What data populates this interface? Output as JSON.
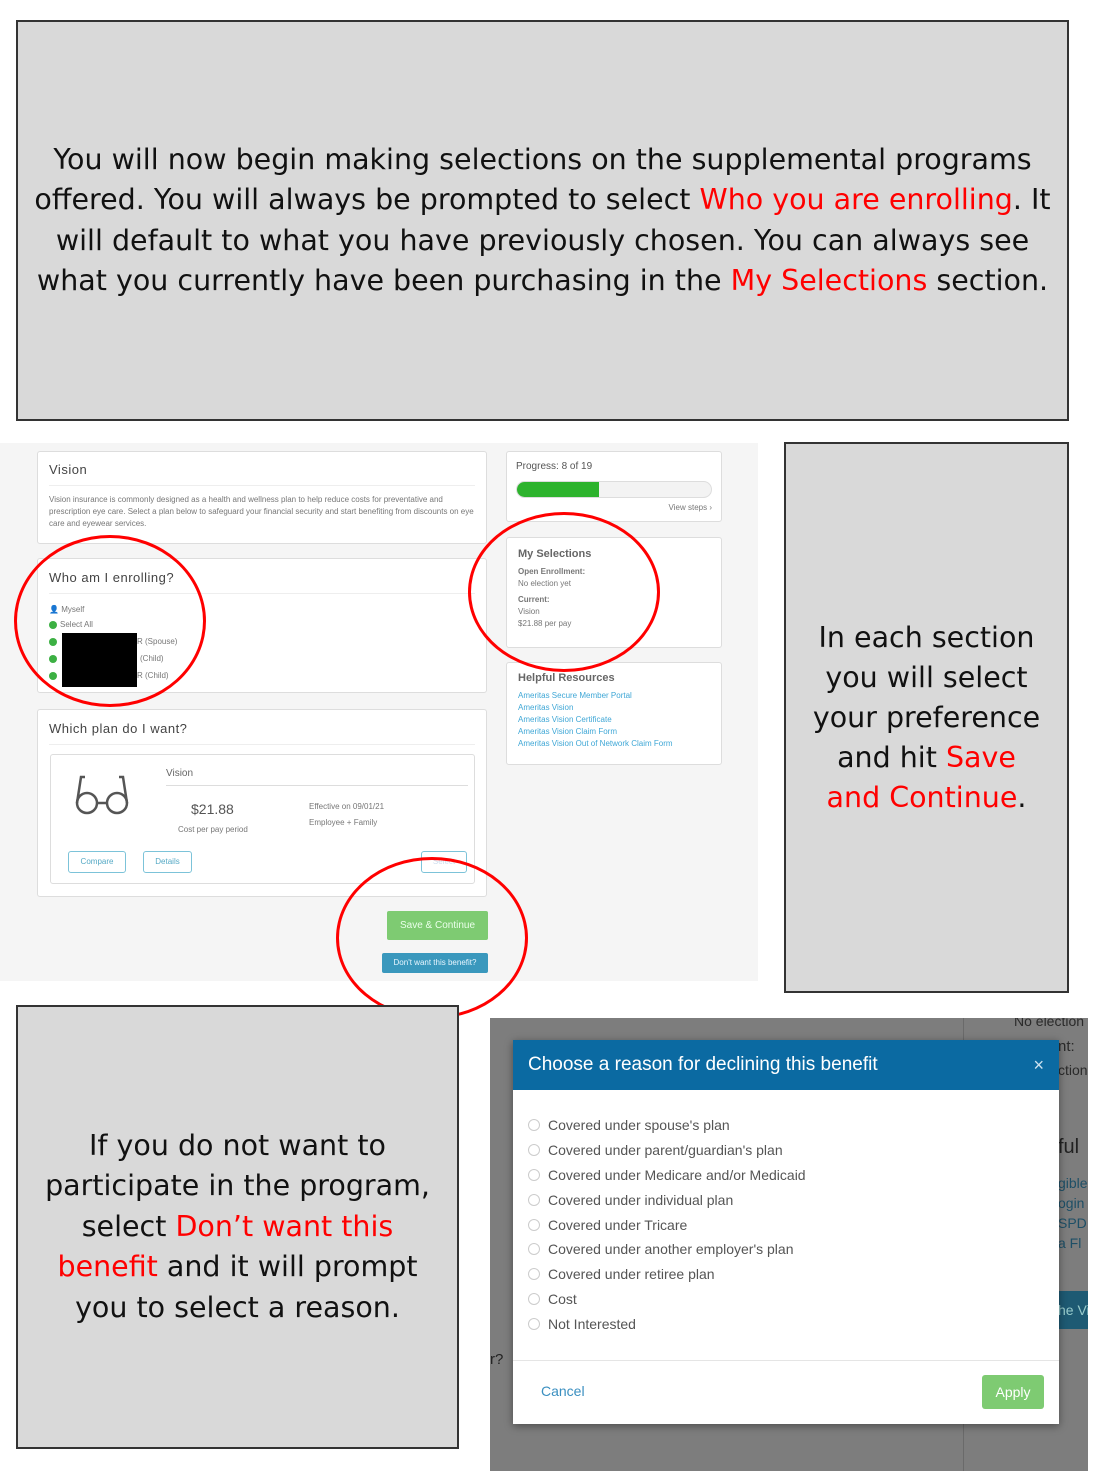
{
  "intro": {
    "p1": "You will now begin making selections on the supplemental programs offered. You will always be prompted to select ",
    "h1": "Who you are enrolling",
    "p2": ". It will default to what you have previously chosen. You can always see what you currently have been purchasing in the ",
    "h2": "My Selections",
    "p3": " section."
  },
  "side_note": {
    "p1": "In each section you will select your preference and hit ",
    "h1": "Save and Continue",
    "p2": "."
  },
  "bottom_note": {
    "p1": "If you do not want to participate in the program, select ",
    "h1": "Don’t want this benefit",
    "p2": " and it will prompt you to select a reason."
  },
  "vision": {
    "title": "Vision",
    "description": "Vision insurance is commonly designed as a health and wellness plan to help reduce costs for preventative and prescription eye care. Select a plan below to safeguard your financial security and start benefiting from discounts on eye care and eyewear services."
  },
  "enrolling": {
    "title": "Who am I enrolling?",
    "myself": "Myself",
    "select_all": "Select All",
    "dependents": [
      "R (Spouse)",
      "(Child)",
      "R (Child)"
    ]
  },
  "plan": {
    "title": "Which plan do I want?",
    "name": "Vision",
    "price": "$21.88",
    "price_caption": "Cost per pay period",
    "effective": "Effective on 09/01/21",
    "coverage": "Employee + Family",
    "compare": "Compare",
    "details": "Details",
    "select": "Select"
  },
  "actions": {
    "save": "Save & Continue",
    "decline": "Don't want this benefit?"
  },
  "progress": {
    "label": "Progress: 8 of 19",
    "current": 8,
    "total": 19,
    "view_steps": "View steps"
  },
  "selections": {
    "title": "My Selections",
    "open_label": "Open Enrollment:",
    "open_value": "No election yet",
    "current_label": "Current:",
    "current_plan": "Vision",
    "current_cost": "$21.88 per pay"
  },
  "resources": {
    "title": "Helpful Resources",
    "links": [
      "Ameritas Secure Member Portal",
      "Ameritas Vision",
      "Ameritas Vision Certificate",
      "Ameritas Vision Claim Form",
      "Ameritas Vision Out of Network Claim Form"
    ]
  },
  "modal": {
    "title": "Choose a reason for declining this benefit",
    "options": [
      "Covered under spouse's plan",
      "Covered under parent/guardian's plan",
      "Covered under Medicare and/or Medicaid",
      "Covered under individual plan",
      "Covered under Tricare",
      "Covered under another employer's plan",
      "Covered under retiree plan",
      "Cost",
      "Not Interested"
    ],
    "cancel": "Cancel",
    "apply": "Apply"
  },
  "background_fragments": [
    "No election",
    "nt:",
    "ction",
    "ful",
    "gible",
    "ogin",
    "SPD",
    "a Fl",
    "he Vi",
    "r?"
  ],
  "colors": {
    "highlight": "#ff0000",
    "modal_header": "#0b6aa2",
    "save": "#7ecb72",
    "decline": "#3a98bd",
    "progress": "#2db32d"
  }
}
